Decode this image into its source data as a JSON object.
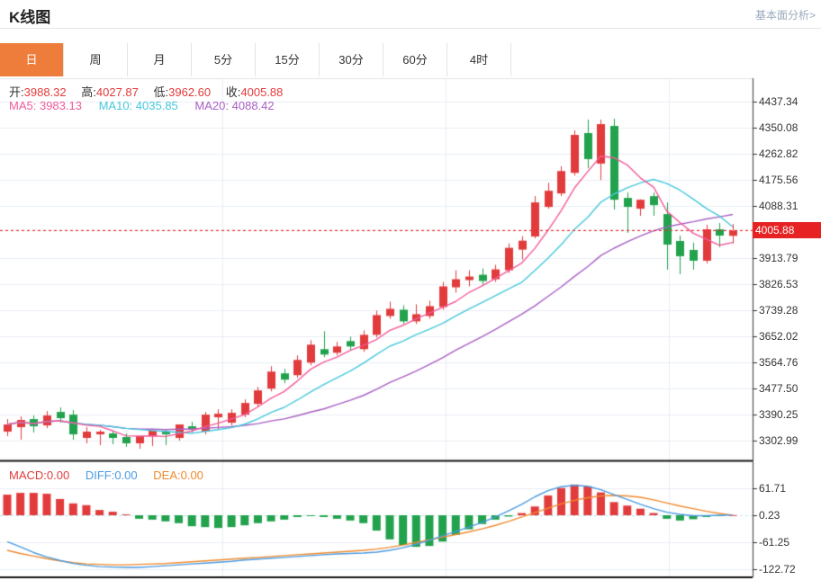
{
  "header": {
    "title": "K线图",
    "analysis_link": "基本面分析>"
  },
  "tabs": {
    "items": [
      "日",
      "周",
      "月",
      "5分",
      "15分",
      "30分",
      "60分",
      "4时"
    ],
    "active_index": 0
  },
  "quote": {
    "open_label": "开:",
    "open": "3988.32",
    "high_label": "高:",
    "high": "4027.87",
    "low_label": "低:",
    "low": "3962.60",
    "close_label": "收:",
    "close": "4005.88"
  },
  "ma_info": {
    "ma5_label": "MA5:",
    "ma5": "3983.13",
    "ma10_label": "MA10:",
    "ma10": "4035.85",
    "ma20_label": "MA20:",
    "ma20": "4088.42"
  },
  "macd_info": {
    "macd_label": "MACD:",
    "macd": "0.00",
    "diff_label": "DIFF:",
    "diff": "0.00",
    "dea_label": "DEA:",
    "dea": "0.00"
  },
  "colors": {
    "up": "#e23b3c",
    "down": "#22a24d",
    "ma5": "#f25b9b",
    "ma10": "#45c8dc",
    "ma20": "#a95fc4",
    "diff": "#4a9be0",
    "dea": "#f08a2e",
    "tab_active_bg": "#ee7d3c",
    "price_flag_bg": "#e62222",
    "grid": "#e8edf4",
    "axis": "#555555",
    "separator": "#151515",
    "current_price_line": "#e62e2e",
    "macd_zero_line": "#bfe0f0"
  },
  "chart_data": {
    "type": "candlestick",
    "title": "K线图 daily candles with MA5/MA10/MA20 overlays and MACD pane",
    "price_axis_ticks": [
      4437.34,
      4350.08,
      4262.82,
      4175.56,
      4088.31,
      3913.79,
      3826.53,
      3739.28,
      3652.02,
      3564.76,
      3477.5,
      3390.25,
      3302.99
    ],
    "current_price": 4005.88,
    "current_price_label": "4005.88",
    "ma_periods": [
      5,
      10,
      20
    ],
    "candles_ohlc": [
      [
        3333,
        3375,
        3318,
        3357
      ],
      [
        3348,
        3384,
        3306,
        3372
      ],
      [
        3375,
        3387,
        3330,
        3351
      ],
      [
        3354,
        3402,
        3345,
        3387
      ],
      [
        3399,
        3414,
        3363,
        3378
      ],
      [
        3390,
        3405,
        3306,
        3324
      ],
      [
        3312,
        3348,
        3294,
        3333
      ],
      [
        3324,
        3339,
        3288,
        3333
      ],
      [
        3327,
        3333,
        3291,
        3312
      ],
      [
        3315,
        3327,
        3282,
        3294
      ],
      [
        3294,
        3306,
        3276,
        3318
      ],
      [
        3318,
        3330,
        3285,
        3336
      ],
      [
        3333,
        3342,
        3288,
        3324
      ],
      [
        3312,
        3345,
        3303,
        3357
      ],
      [
        3351,
        3366,
        3330,
        3342
      ],
      [
        3333,
        3399,
        3324,
        3390
      ],
      [
        3381,
        3408,
        3342,
        3393
      ],
      [
        3363,
        3408,
        3354,
        3396
      ],
      [
        3390,
        3441,
        3381,
        3429
      ],
      [
        3426,
        3483,
        3417,
        3471
      ],
      [
        3477,
        3552,
        3468,
        3534
      ],
      [
        3528,
        3543,
        3495,
        3507
      ],
      [
        3522,
        3588,
        3513,
        3573
      ],
      [
        3564,
        3639,
        3555,
        3624
      ],
      [
        3609,
        3669,
        3582,
        3591
      ],
      [
        3597,
        3633,
        3588,
        3618
      ],
      [
        3636,
        3651,
        3606,
        3618
      ],
      [
        3609,
        3672,
        3600,
        3657
      ],
      [
        3657,
        3738,
        3648,
        3723
      ],
      [
        3720,
        3768,
        3711,
        3744
      ],
      [
        3741,
        3756,
        3693,
        3702
      ],
      [
        3702,
        3759,
        3693,
        3726
      ],
      [
        3720,
        3771,
        3711,
        3753
      ],
      [
        3750,
        3834,
        3741,
        3819
      ],
      [
        3816,
        3873,
        3798,
        3843
      ],
      [
        3840,
        3873,
        3819,
        3852
      ],
      [
        3858,
        3879,
        3825,
        3837
      ],
      [
        3843,
        3891,
        3834,
        3876
      ],
      [
        3873,
        3963,
        3864,
        3948
      ],
      [
        3942,
        3987,
        3909,
        3972
      ],
      [
        3986,
        4121,
        3980,
        4100
      ],
      [
        4085,
        4166,
        4079,
        4139
      ],
      [
        4130,
        4221,
        4121,
        4205
      ],
      [
        4199,
        4341,
        4190,
        4326
      ],
      [
        4332,
        4377,
        4214,
        4245
      ],
      [
        4230,
        4377,
        4175,
        4362
      ],
      [
        4356,
        4380,
        4076,
        4109
      ],
      [
        4115,
        4133,
        3998,
        4085
      ],
      [
        4079,
        4110,
        4055,
        4109
      ],
      [
        4121,
        4133,
        4055,
        4091
      ],
      [
        4061,
        4100,
        3875,
        3959
      ],
      [
        3971,
        3989,
        3860,
        3920
      ],
      [
        3941,
        3965,
        3875,
        3905
      ],
      [
        3905,
        4025,
        3896,
        4010
      ],
      [
        4010,
        4031,
        3950,
        3989
      ],
      [
        3988.32,
        4027.87,
        3962.6,
        4005.88
      ]
    ],
    "macd": {
      "axis_ticks": [
        61.71,
        0.23,
        -61.25,
        -122.72
      ],
      "hist": [
        47,
        51,
        51,
        49,
        37,
        27,
        23,
        12,
        8,
        2,
        -8,
        -10,
        -14,
        -18,
        -25,
        -27,
        -29,
        -27,
        -23,
        -18,
        -14,
        -10,
        -4,
        -2,
        -4,
        -8,
        -12,
        -18,
        -35,
        -55,
        -68,
        -72,
        -70,
        -60,
        -45,
        -32,
        -20,
        -10,
        -3,
        5,
        20,
        45,
        62,
        70,
        66,
        52,
        30,
        22,
        15,
        5,
        -8,
        -12,
        -9,
        -4,
        -1,
        0.5
      ],
      "diff": [
        -60,
        -72,
        -85,
        -95,
        -103,
        -110,
        -114,
        -117,
        -118,
        -119,
        -119,
        -117,
        -115,
        -113,
        -111,
        -109,
        -107,
        -105,
        -102,
        -100,
        -98,
        -96,
        -94,
        -92,
        -90,
        -88,
        -87,
        -86,
        -84,
        -80,
        -74,
        -66,
        -57,
        -47,
        -37,
        -27,
        -16,
        -4,
        10,
        25,
        42,
        56,
        65,
        68,
        66,
        58,
        47,
        36,
        25,
        15,
        7,
        2,
        -1,
        -1,
        0,
        0.2
      ],
      "dea": [
        -80,
        -87,
        -93,
        -99,
        -104,
        -108,
        -111,
        -112,
        -113,
        -113,
        -112,
        -111,
        -110,
        -108,
        -106,
        -104,
        -102,
        -100,
        -98,
        -96,
        -94,
        -92,
        -90,
        -88,
        -86,
        -84,
        -82,
        -80,
        -77,
        -73,
        -68,
        -62,
        -56,
        -50,
        -44,
        -38,
        -31,
        -23,
        -14,
        -4,
        6,
        16,
        26,
        34,
        40,
        44,
        45,
        44,
        41,
        35,
        28,
        21,
        15,
        9,
        4,
        0.2
      ]
    }
  }
}
